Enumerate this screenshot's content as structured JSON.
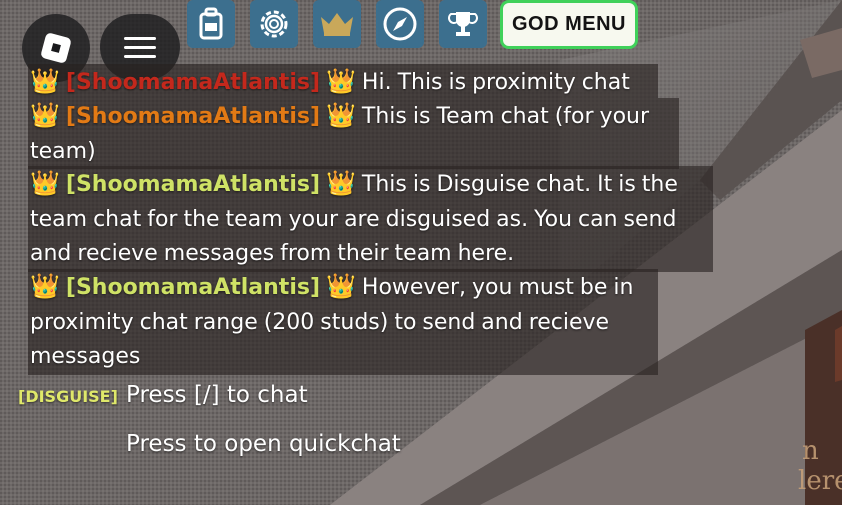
{
  "colors": {
    "accent_border": "#40d15a",
    "topbar_button_bg": "#3c6f8e",
    "name_red": "#c4281c",
    "name_orange": "#e27a15",
    "name_green": "#cfe266",
    "disguise_label": "#dfe86a"
  },
  "topbar": {
    "logo_icon": "roblox-logo-icon",
    "menu_icon": "hamburger-menu-icon",
    "buttons": [
      {
        "icon": "backpack-icon"
      },
      {
        "icon": "gear-icon"
      },
      {
        "icon": "crown-icon"
      },
      {
        "icon": "compass-icon"
      },
      {
        "icon": "trophy-icon"
      }
    ],
    "god_menu_label": "GOD MENU"
  },
  "chat": {
    "messages": [
      {
        "prefix_icon": "crown-emoji",
        "sender": "[ShoomamaAtlantis]",
        "sender_color": "red",
        "text": "Hi. This is proximity chat"
      },
      {
        "prefix_icon": "crown-emoji",
        "sender": "[ShoomamaAtlantis]",
        "sender_color": "orange",
        "text": "This is Team chat (for your team)"
      },
      {
        "prefix_icon": "crown-emoji",
        "sender": "[ShoomamaAtlantis]",
        "sender_color": "green",
        "text": "This is Disguise chat. It is the team chat for the team your are disguised as. You can send and recieve messages from their team here."
      },
      {
        "prefix_icon": "crown-emoji",
        "sender": "[ShoomamaAtlantis]",
        "sender_color": "green",
        "text": "However, you must be in proximity chat range (200 studs) to send and recieve messages"
      }
    ],
    "channel_label": "[DISGUISE]",
    "input_hint": "Press [/] to chat",
    "quickchat_hint": "Press to open quickchat"
  },
  "scene": {
    "sign_text": "n\nlere"
  }
}
